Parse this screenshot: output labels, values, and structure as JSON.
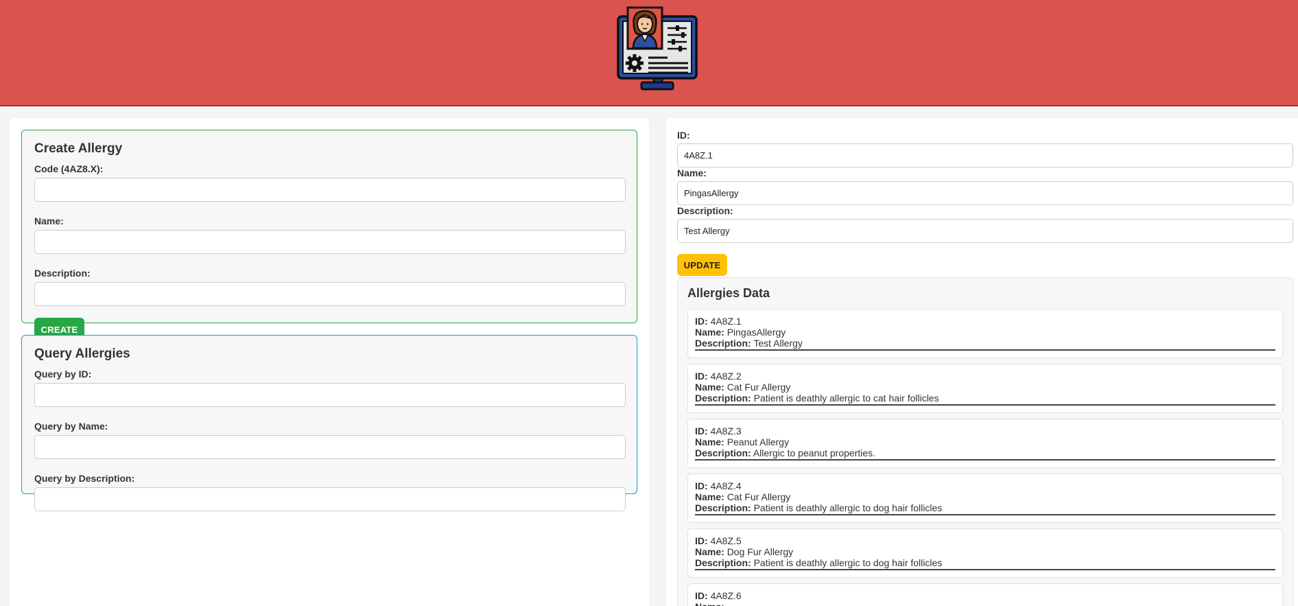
{
  "create_form": {
    "title": "Create Allergy",
    "code_label": "Code (4AZ8.X):",
    "code_value": "",
    "name_label": "Name:",
    "name_value": "",
    "description_label": "Description:",
    "description_value": "",
    "button_label": "CREATE"
  },
  "query_form": {
    "title": "Query Allergies",
    "id_label": "Query by ID:",
    "id_value": "",
    "name_label": "Query by Name:",
    "name_value": "",
    "description_label": "Query by Description:",
    "description_value": ""
  },
  "update_form": {
    "id_label": "ID:",
    "id_value": "4A8Z.1",
    "name_label": "Name:",
    "name_value": "PingasAllergy",
    "description_label": "Description:",
    "description_value": "Test Allergy",
    "button_label": "UPDATE"
  },
  "allergies": {
    "title": "Allergies Data",
    "id_key": "ID:",
    "name_key": "Name:",
    "description_key": "Description:",
    "records": [
      {
        "id": "4A8Z.1",
        "name": "PingasAllergy",
        "description": "Test Allergy"
      },
      {
        "id": "4A8Z.2",
        "name": "Cat Fur Allergy",
        "description": "Patient is deathly allergic to cat hair follicles"
      },
      {
        "id": "4A8Z.3",
        "name": "Peanut Allergy",
        "description": "Allergic to peanut properties."
      },
      {
        "id": "4A8Z.4",
        "name": "Cat Fur Allergy",
        "description": "Patient is deathly allergic to dog hair follicles"
      },
      {
        "id": "4A8Z.5",
        "name": "Dog Fur Allergy",
        "description": "Patient is deathly allergic to dog hair follicles"
      },
      {
        "id": "4A8Z.6",
        "name": "",
        "description": ""
      }
    ]
  },
  "colors": {
    "header_bg": "#db534f",
    "create_accent": "#28a745",
    "query_accent": "#17a2b8",
    "update_button": "#ffc107"
  },
  "icons": {
    "logo": "doctor-monitor-icon"
  }
}
